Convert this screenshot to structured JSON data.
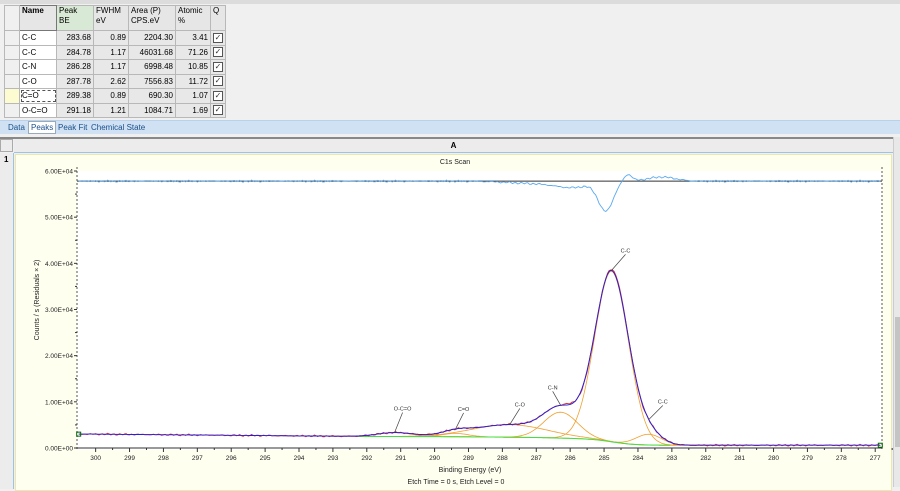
{
  "peaks_table": {
    "headers": [
      {
        "line1": "Name",
        "line2": ""
      },
      {
        "line1": "Peak",
        "line2": "BE"
      },
      {
        "line1": "FWHM",
        "line2": "eV"
      },
      {
        "line1": "Area (P)",
        "line2": "CPS.eV"
      },
      {
        "line1": "Atomic",
        "line2": "%"
      },
      {
        "line1": "Q",
        "line2": ""
      }
    ],
    "rows": [
      {
        "name": "C-C",
        "be": "283.68",
        "fwhm": "0.89",
        "area": "2204.30",
        "atomic": "3.41",
        "q": true
      },
      {
        "name": "C-C",
        "be": "284.78",
        "fwhm": "1.17",
        "area": "46031.68",
        "atomic": "71.26",
        "q": true
      },
      {
        "name": "C-N",
        "be": "286.28",
        "fwhm": "1.17",
        "area": "6998.48",
        "atomic": "10.85",
        "q": true
      },
      {
        "name": "C-O",
        "be": "287.78",
        "fwhm": "2.62",
        "area": "7556.83",
        "atomic": "11.72",
        "q": true
      },
      {
        "name": "C=O",
        "be": "289.38",
        "fwhm": "0.89",
        "area": "690.30",
        "atomic": "1.07",
        "q": true
      },
      {
        "name": "O-C=O",
        "be": "291.18",
        "fwhm": "1.21",
        "area": "1084.71",
        "atomic": "1.69",
        "q": true
      }
    ],
    "active_row": 4
  },
  "tabs": [
    {
      "label": "Data",
      "active": false
    },
    {
      "label": "Peaks",
      "active": true
    },
    {
      "label": "Peak Fit",
      "active": false
    },
    {
      "label": "Chemical State",
      "active": false
    }
  ],
  "sheet": {
    "column_header": "A",
    "row_header": "1"
  },
  "chart_data": {
    "type": "line",
    "title": "C1s Scan",
    "xlabel": "Binding Energy (eV)",
    "ylabel": "Counts / s  (Residuals × 2)",
    "footer": "Etch Time = 0 s, Etch Level = 0",
    "xlim": [
      300.55,
      276.8
    ],
    "x_reversed": true,
    "ylim": [
      0,
      60000
    ],
    "x_ticks": [
      300,
      299,
      298,
      297,
      296,
      295,
      294,
      293,
      292,
      291,
      290,
      289,
      288,
      287,
      286,
      285,
      284,
      283,
      282,
      281,
      280,
      279,
      278,
      277
    ],
    "y_ticks": [
      {
        "value": 0,
        "label": "0.00E+00"
      },
      {
        "value": 10000,
        "label": "1.00E+04"
      },
      {
        "value": 20000,
        "label": "2.00E+04"
      },
      {
        "value": 30000,
        "label": "3.00E+04"
      },
      {
        "value": 40000,
        "label": "4.00E+04"
      },
      {
        "value": 50000,
        "label": "5.00E+04"
      },
      {
        "value": 60000,
        "label": "6.00E+04"
      }
    ],
    "residual_baseline": 57800,
    "background": {
      "high_be_value": 3000,
      "plateau_value": 2500,
      "low_be_value": 600,
      "range": [
        292.3,
        283.0
      ]
    },
    "peak_labels": [
      {
        "label": "C-C",
        "be": 283.68
      },
      {
        "label": "C-C",
        "be": 284.78
      },
      {
        "label": "C-N",
        "be": 286.28
      },
      {
        "label": "C-O",
        "be": 287.78
      },
      {
        "label": "C=O",
        "be": 289.38
      },
      {
        "label": "O-C=O",
        "be": 291.18
      }
    ],
    "colors": {
      "envelope": "#2020e0",
      "data": "#e03030",
      "components": "#f0a030",
      "background": "#40e040",
      "residual": "#5aaaf0",
      "axis": "#333333"
    }
  }
}
